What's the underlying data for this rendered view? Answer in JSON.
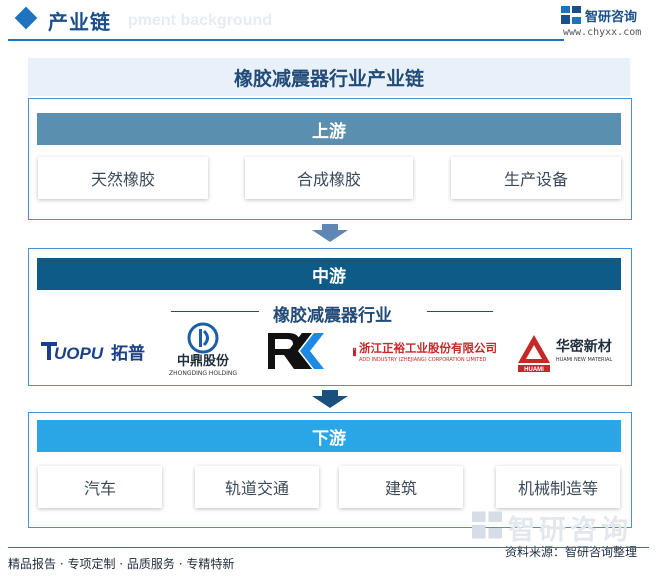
{
  "header": {
    "title": "产业链",
    "ghost_text": "pment background",
    "brand_name": "智研咨询",
    "brand_url": "www.chyxx.com"
  },
  "main_title": "橡胶减震器行业产业链",
  "upstream": {
    "label": "上游",
    "items": [
      "天然橡胶",
      "合成橡胶",
      "生产设备"
    ]
  },
  "midstream": {
    "label": "中游",
    "sub_title": "橡胶减震器行业",
    "logos": [
      {
        "name": "TUOPU拓普",
        "text": "TUOPU 拓普"
      },
      {
        "name": "中鼎股份",
        "text": "中鼎股份",
        "sub": "ZHONGDING HOLDING"
      },
      {
        "name": "RK",
        "text": "RK"
      },
      {
        "name": "浙江正裕",
        "text": "浙江正裕工业股份有限公司",
        "sub": "ADD INDUSTRY (ZHEJIANG) CORPORATION LIMITED"
      },
      {
        "name": "华密新材",
        "text": "华密新材",
        "sub": "HUAMI NEW MATERIAL",
        "mark": "HUAMI"
      }
    ]
  },
  "downstream": {
    "label": "下游",
    "items": [
      "汽车",
      "轨道交通",
      "建筑",
      "机械制造等"
    ]
  },
  "watermark": "智研咨询",
  "footer": {
    "left": "精品报告 · 专项定制 · 品质服务 · 专精特新",
    "source": "资料来源：智研咨询整理"
  },
  "colors": {
    "upstream_bar": "#5b8fb0",
    "midstream_bar": "#0d5b86",
    "downstream_bar": "#2aa5e6",
    "accent": "#1e73be"
  }
}
